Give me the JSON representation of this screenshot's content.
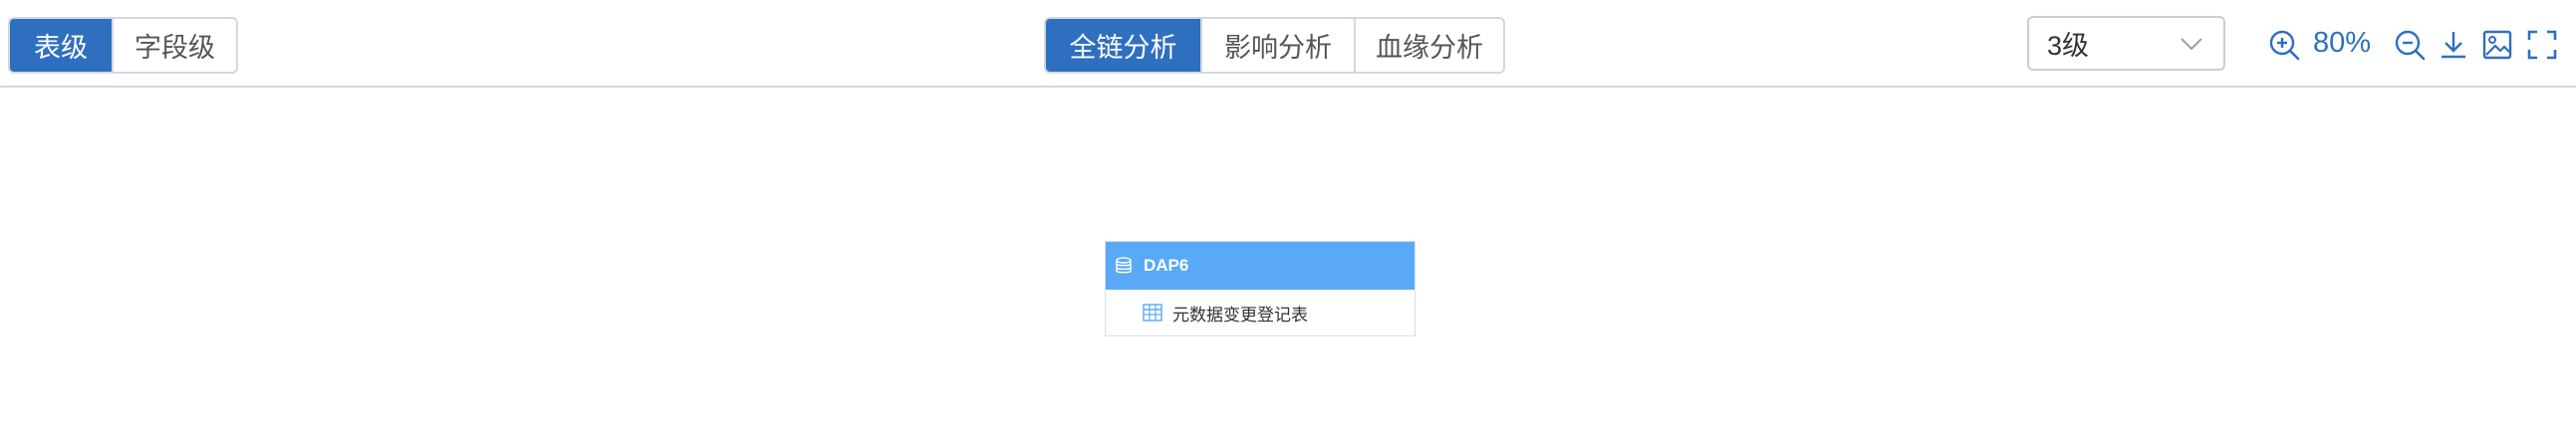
{
  "toolbar": {
    "level_tabs": [
      "表级",
      "字段级"
    ],
    "analysis_tabs": [
      "全链分析",
      "影响分析",
      "血缘分析"
    ],
    "depth_select": {
      "value": "3级"
    },
    "zoom": "80%",
    "icons": [
      "zoom-in-icon",
      "zoom-out-icon",
      "download-icon",
      "image-export-icon",
      "fullscreen-icon"
    ],
    "accent_color": "#2f6fbf"
  },
  "graph": {
    "node": {
      "title": "DAP6",
      "header_color": "#5aa9f7",
      "rows": [
        {
          "label": "元数据变更登记表"
        }
      ]
    }
  }
}
